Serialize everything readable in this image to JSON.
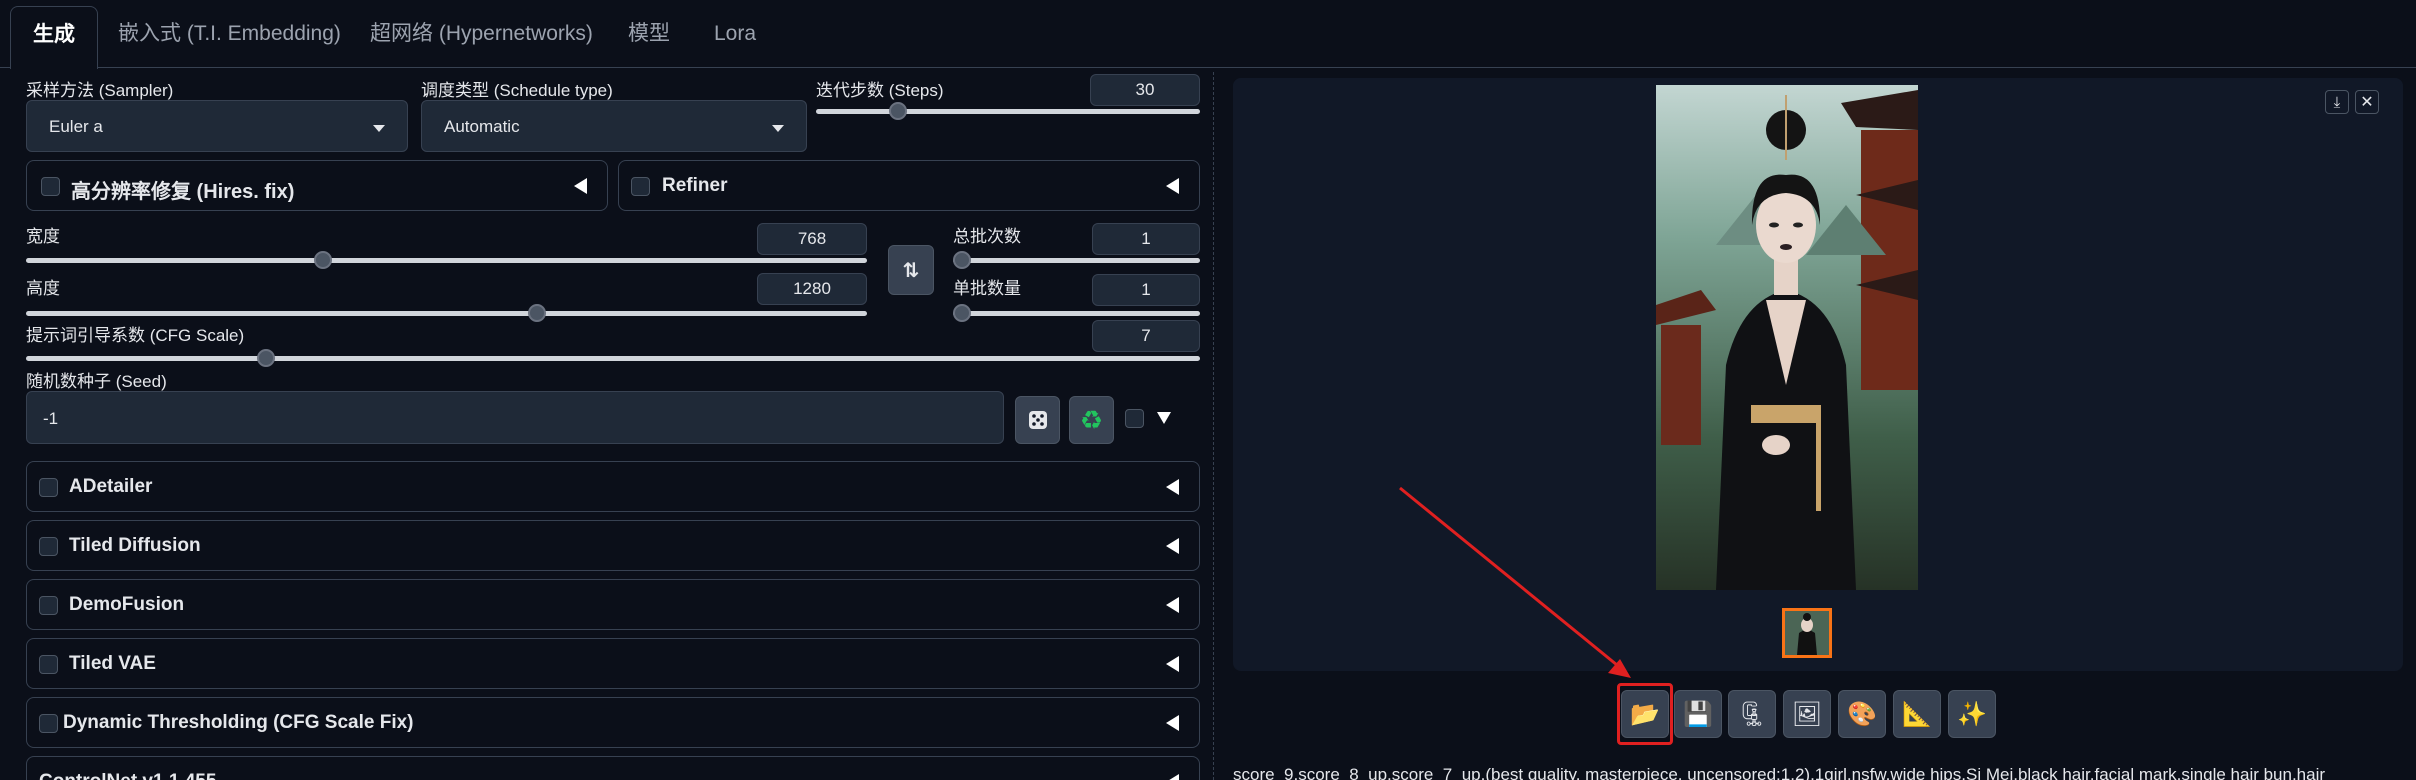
{
  "tabs": [
    {
      "label": "生成",
      "active": true
    },
    {
      "label": "嵌入式 (T.I. Embedding)"
    },
    {
      "label": "超网络 (Hypernetworks)"
    },
    {
      "label": "模型"
    },
    {
      "label": "Lora"
    }
  ],
  "sampler": {
    "label": "采样方法 (Sampler)",
    "value": "Euler a"
  },
  "schedule": {
    "label": "调度类型 (Schedule type)",
    "value": "Automatic"
  },
  "steps": {
    "label": "迭代步数 (Steps)",
    "value": "30",
    "level": 0.2
  },
  "hires": {
    "label": "高分辨率修复 (Hires. fix)"
  },
  "refiner": {
    "label": "Refiner"
  },
  "width": {
    "label": "宽度",
    "value": "768",
    "level": 0.35
  },
  "height": {
    "label": "高度",
    "value": "1280",
    "level": 0.61
  },
  "batch_count": {
    "label": "总批次数",
    "value": "1",
    "level": 0
  },
  "batch_size": {
    "label": "单批数量",
    "value": "1",
    "level": 0
  },
  "swap_icon": "swap-arrows-icon",
  "cfg": {
    "label": "提示词引导系数 (CFG Scale)",
    "value": "7",
    "level": 0.2
  },
  "seed": {
    "label": "随机数种子 (Seed)",
    "value": "-1",
    "dice_icon": "dice-icon",
    "recycle_icon": "recycle-icon"
  },
  "accordions": [
    {
      "label": "ADetailer"
    },
    {
      "label": "Tiled Diffusion"
    },
    {
      "label": "DemoFusion"
    },
    {
      "label": "Tiled VAE"
    },
    {
      "label": "Dynamic Thresholding (CFG Scale Fix)"
    },
    {
      "label": "ControlNet v1.1.455"
    }
  ],
  "gallery": {
    "download_icon": "download-icon",
    "close_icon": "close-icon",
    "image_subject": "generated-portrait-image"
  },
  "toolbar": [
    {
      "icon": "folder-icon",
      "glyph": "📂",
      "highlighted": true
    },
    {
      "icon": "save-icon",
      "glyph": "💾"
    },
    {
      "icon": "zip-icon",
      "glyph": "🗜"
    },
    {
      "icon": "img2img-icon",
      "glyph": "🖼"
    },
    {
      "icon": "palette-icon",
      "glyph": "🎨"
    },
    {
      "icon": "ruler-icon",
      "glyph": "📐"
    },
    {
      "icon": "sparkle-icon",
      "glyph": "✨"
    }
  ],
  "prompt_output": "score_9,score_8_up,score_7_up,(best quality, masterpiece, uncensored:1.2),1girl,nsfw,wide hips,Si Mei,black hair,facial mark,single hair bun,hair",
  "colors": {
    "accent_red": "#e02020",
    "bg": "#0b0f19",
    "panel": "#1f2937",
    "border": "#374151"
  }
}
